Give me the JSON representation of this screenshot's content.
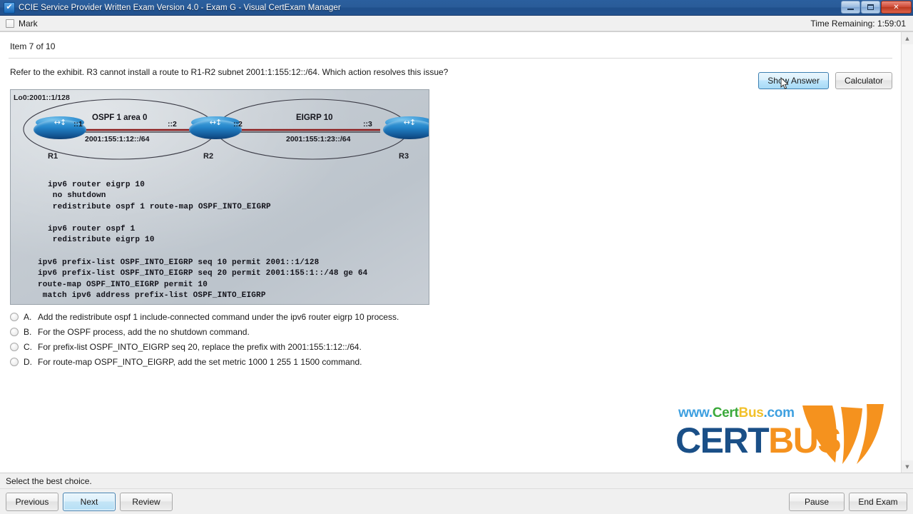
{
  "window": {
    "title": "CCIE Service Provider Written Exam Version 4.0 - Exam G - Visual CertExam Manager",
    "app_icon": "checkbox-check-icon",
    "minimize_label": "–",
    "maximize_label": "□",
    "close_label": "✕"
  },
  "markbar": {
    "mark_label": "Mark",
    "time_remaining": "Time Remaining: 1:59:01"
  },
  "header": {
    "item_counter": "Item 7 of 10",
    "show_answer_label": "Show Answer",
    "calculator_label": "Calculator"
  },
  "question": {
    "text": "Refer to the exhibit. R3 cannot install a route to R1-R2 subnet 2001:1:155:12::/64. Which action resolves this issue?"
  },
  "exhibit": {
    "loopback_label": "Lo0:2001::1/128",
    "routers": [
      {
        "name": "R1",
        "interface": "::1"
      },
      {
        "name": "R2",
        "interface_left": "::2",
        "interface_right": "::2"
      },
      {
        "name": "R3",
        "interface": "::3"
      }
    ],
    "clouds": [
      {
        "protocol": "OSPF 1 area 0",
        "subnet": "2001:155:1:12::/64"
      },
      {
        "protocol": "EIGRP 10",
        "subnet": "2001:155:1:23::/64"
      }
    ],
    "config_block_1": "ipv6 router eigrp 10\n no shutdown\n redistribute ospf 1 route-map OSPF_INTO_EIGRP",
    "config_block_2": "ipv6 router ospf 1\n redistribute eigrp 10",
    "config_block_3": "ipv6 prefix-list OSPF_INTO_EIGRP seq 10 permit 2001::1/128\nipv6 prefix-list OSPF_INTO_EIGRP seq 20 permit 2001:155:1::/48 ge 64\nroute-map OSPF_INTO_EIGRP permit 10\n match ipv6 address prefix-list OSPF_INTO_EIGRP"
  },
  "options": [
    {
      "letter": "A.",
      "text": "Add the redistribute ospf 1 include-connected command under the ipv6 router eigrp 10 process.",
      "selected": false
    },
    {
      "letter": "B.",
      "text": "For the OSPF process, add the no shutdown command.",
      "selected": false
    },
    {
      "letter": "C.",
      "text": "For prefix-list OSPF_INTO_EIGRP seq 20, replace the prefix with 2001:155:1:12::/64.",
      "selected": false
    },
    {
      "letter": "D.",
      "text": "For route-map OSPF_INTO_EIGRP, add the set metric 1000 1 255 1 1500 command.",
      "selected": false
    }
  ],
  "logo": {
    "url_prefix": "www.",
    "url_cert": "Cert",
    "url_bus": "Bus",
    "url_dotcom": ".com",
    "word_cert": "CERT",
    "word_bus": "BUS",
    "color_blue": "#1a4f87",
    "color_orange": "#f5921e"
  },
  "scrollbar": {
    "up_arrow": "▲",
    "down_arrow": "▼"
  },
  "status": {
    "text": "Select the best choice."
  },
  "footer": {
    "previous_label": "Previous",
    "next_label": "Next",
    "review_label": "Review",
    "pause_label": "Pause",
    "end_exam_label": "End Exam"
  }
}
